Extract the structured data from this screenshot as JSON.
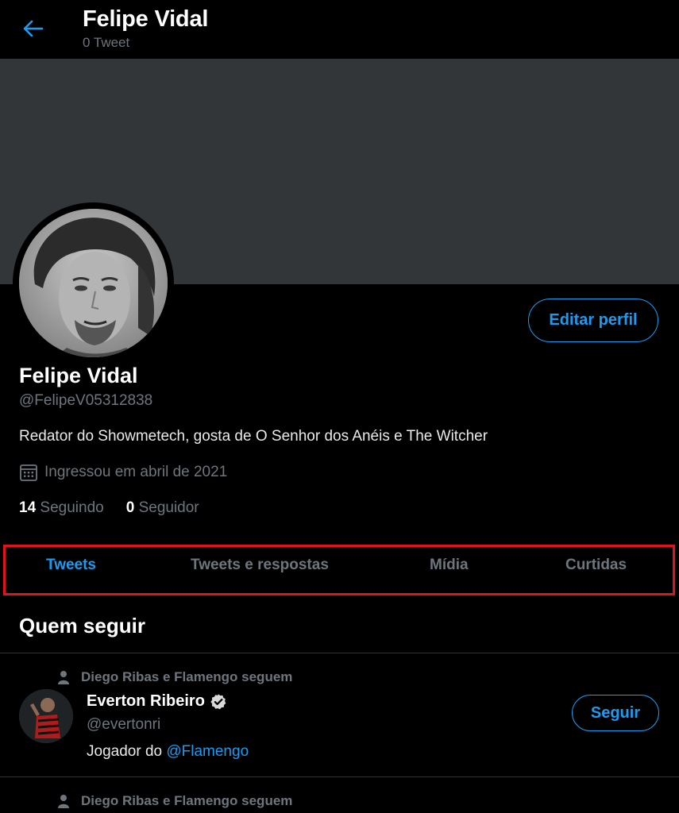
{
  "header": {
    "title": "Felipe Vidal",
    "subtitle": "0 Tweet",
    "back_icon": "arrow-left-icon"
  },
  "profile": {
    "name": "Felipe Vidal",
    "handle": "@FelipeV05312838",
    "bio": "Redator do Showmetech, gosta de O Senhor dos Anéis e The Witcher",
    "joined": "Ingressou em abril de 2021",
    "following_count": "14",
    "following_label": "Seguindo",
    "followers_count": "0",
    "followers_label": "Seguidor",
    "edit_label": "Editar perfil"
  },
  "tabs": [
    {
      "label": "Tweets",
      "active": true
    },
    {
      "label": "Tweets e respostas",
      "active": false
    },
    {
      "label": "Mídia",
      "active": false
    },
    {
      "label": "Curtidas",
      "active": false
    }
  ],
  "who_to_follow": {
    "title": "Quem seguir",
    "suggestions": [
      {
        "context": "Diego Ribas e Flamengo seguem",
        "name": "Everton Ribeiro",
        "handle": "@evertonri",
        "bio_prefix": "Jogador do ",
        "bio_mention": "@Flamengo",
        "follow_label": "Seguir"
      },
      {
        "context": "Diego Ribas e Flamengo seguem"
      }
    ]
  },
  "colors": {
    "accent": "#1d9bf0",
    "background": "#000000",
    "banner": "#333639",
    "highlight_box": "#e0141e",
    "muted_text": "#6e767d"
  }
}
